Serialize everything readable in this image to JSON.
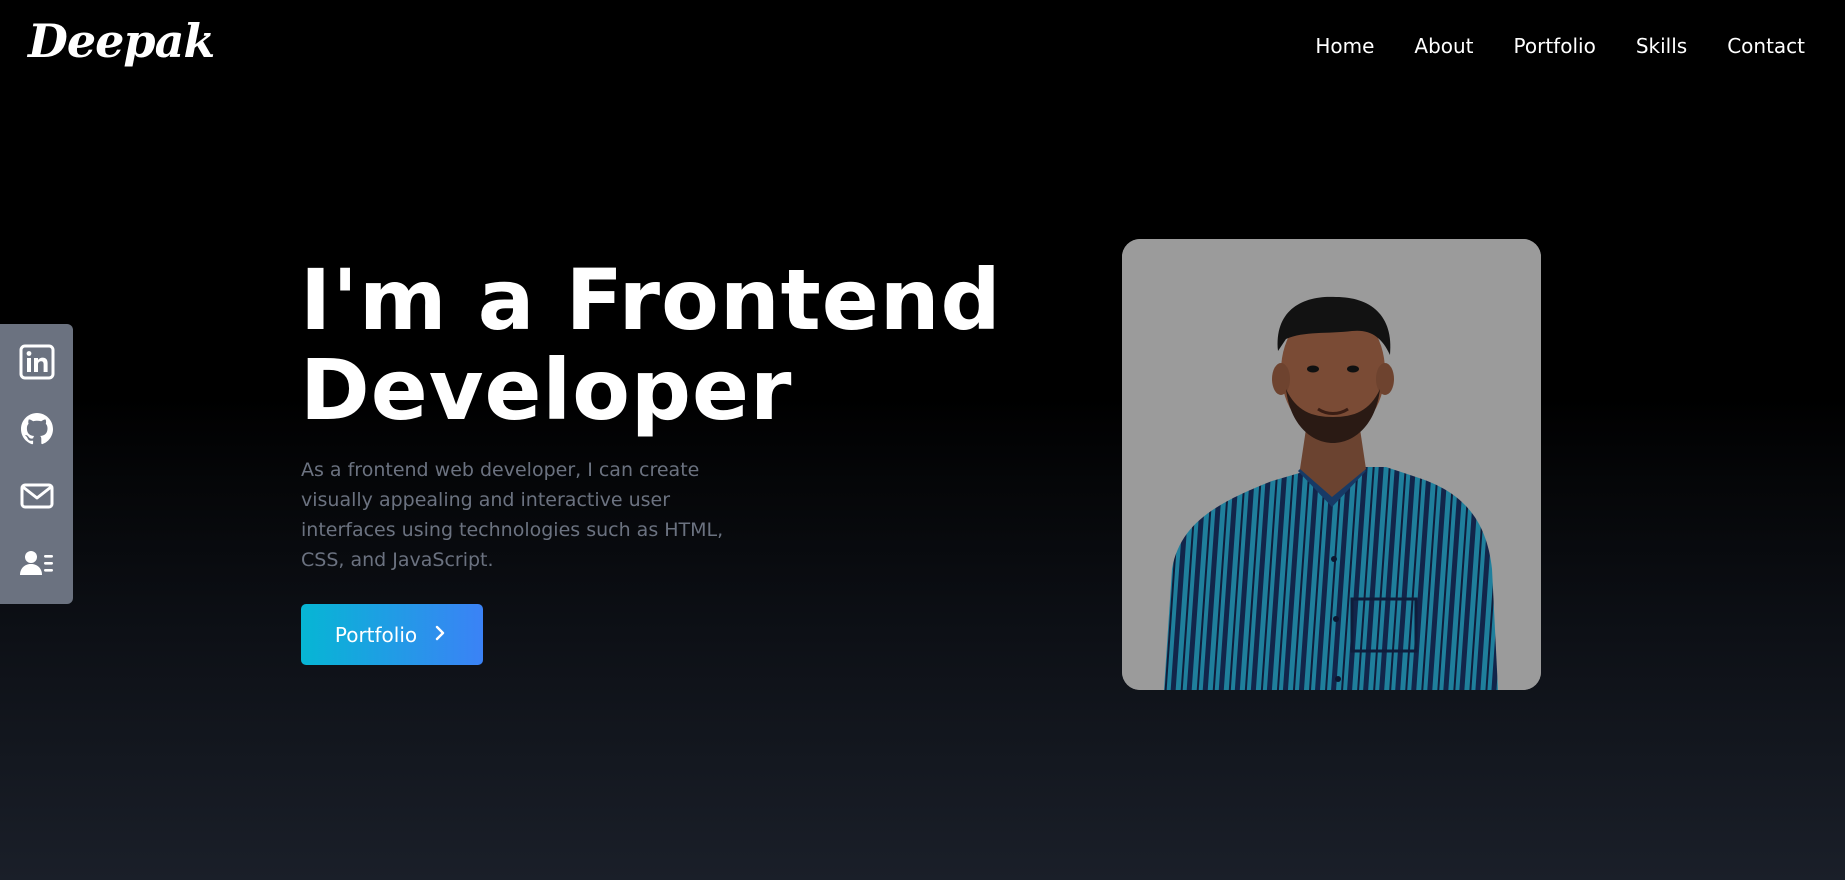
{
  "brand": {
    "logo_text": "Deepak"
  },
  "nav": {
    "items": [
      {
        "label": "Home"
      },
      {
        "label": "About"
      },
      {
        "label": "Portfolio"
      },
      {
        "label": "Skills"
      },
      {
        "label": "Contact"
      }
    ]
  },
  "social": [
    {
      "icon": "linkedin-icon"
    },
    {
      "icon": "github-icon"
    },
    {
      "icon": "mail-icon"
    },
    {
      "icon": "resume-icon"
    }
  ],
  "hero": {
    "title_line1": "I'm a Frontend",
    "title_line2": "Developer",
    "description": "As a frontend web developer, I can create visually appealing and interactive user interfaces using technologies such as HTML, CSS, and JavaScript.",
    "cta_label": "Portfolio",
    "cta_icon": "chevron-right-icon"
  },
  "colors": {
    "accent_start": "#06b6d4",
    "accent_end": "#3b82f6",
    "rail_bg": "#6b7280",
    "muted_text": "#6b7280",
    "photo_bg": "#9b9b9b"
  }
}
